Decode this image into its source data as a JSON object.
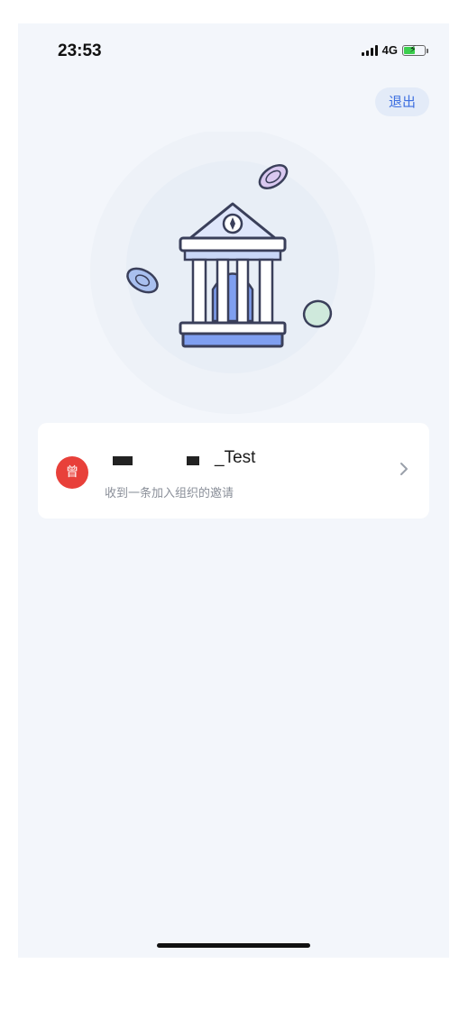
{
  "status_bar": {
    "time": "23:53",
    "network": "4G",
    "battery_level": 0.6
  },
  "header": {
    "logout_label": "退出"
  },
  "invitation": {
    "avatar_text": "曾",
    "org_name": "_Test",
    "subtitle": "收到一条加入组织的邀请"
  },
  "colors": {
    "accent": "#3d6fe0",
    "avatar_bg": "#e8403a",
    "page_bg": "#f3f6fb",
    "illustration_blue": "#7f9ff0"
  },
  "icons": {
    "illustration": "bank-building-icon",
    "chevron": "chevron-right-icon"
  }
}
